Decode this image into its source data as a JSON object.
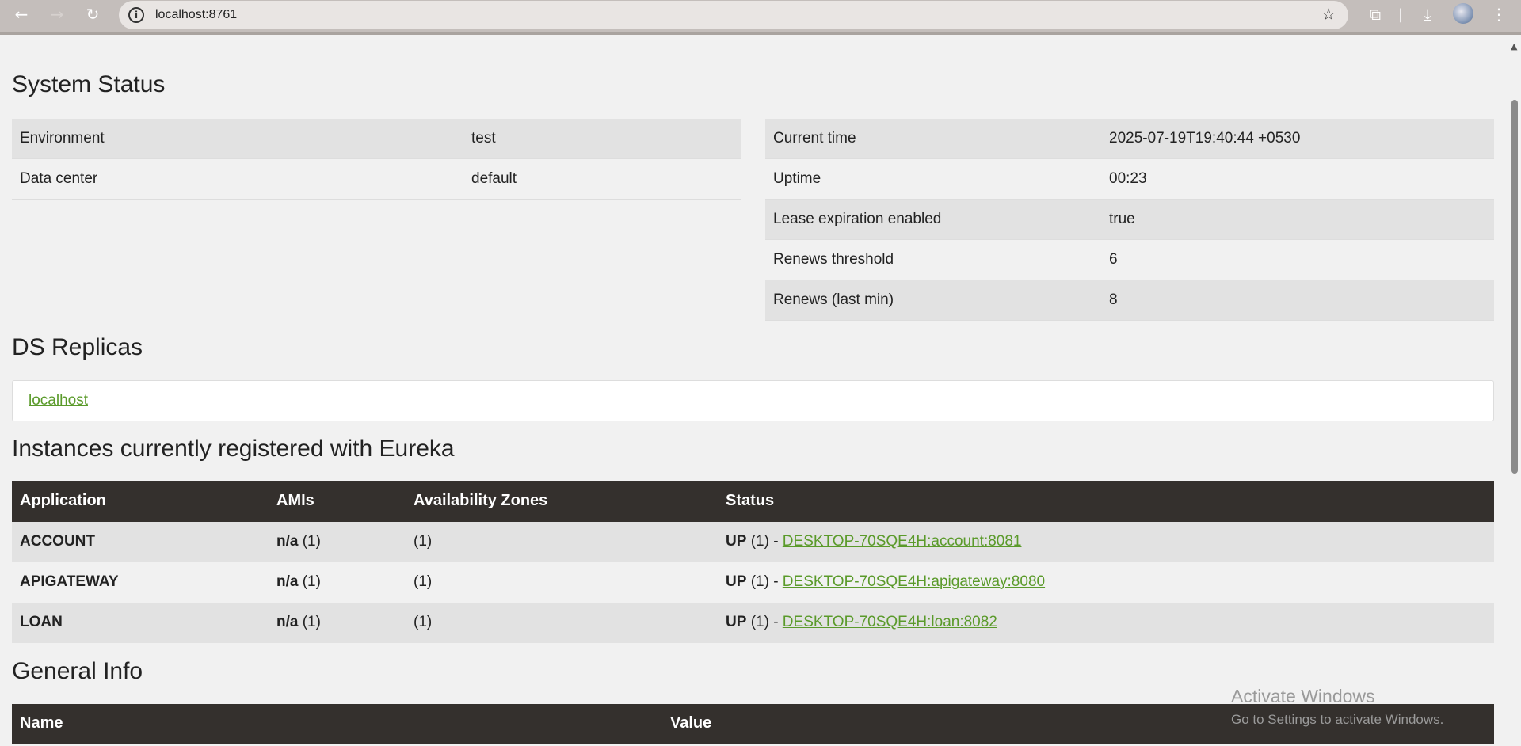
{
  "browser": {
    "back_icon": "arrow-left-icon",
    "forward_icon": "arrow-right-icon",
    "reload_icon": "reload-icon",
    "url": "localhost:8761",
    "info_icon": "info-icon",
    "star_icon": "star-icon",
    "extensions_icon": "puzzle-icon",
    "download_icon": "download-icon",
    "menu_icon": "kebab-menu-icon"
  },
  "system_status": {
    "heading": "System Status",
    "left": [
      {
        "label": "Environment",
        "value": "test"
      },
      {
        "label": "Data center",
        "value": "default"
      }
    ],
    "right": [
      {
        "label": "Current time",
        "value": "2025-07-19T19:40:44 +0530"
      },
      {
        "label": "Uptime",
        "value": "00:23"
      },
      {
        "label": "Lease expiration enabled",
        "value": "true"
      },
      {
        "label": "Renews threshold",
        "value": "6"
      },
      {
        "label": "Renews (last min)",
        "value": "8"
      }
    ]
  },
  "replicas": {
    "heading": "DS Replicas",
    "link": "localhost"
  },
  "instances": {
    "heading": "Instances currently registered with Eureka",
    "columns": [
      "Application",
      "AMIs",
      "Availability Zones",
      "Status"
    ],
    "rows": [
      {
        "application": "ACCOUNT",
        "amis_bold": "n/a",
        "amis_count": "(1)",
        "zones": "(1)",
        "status_bold": "UP",
        "status_count": "(1) -",
        "link": "DESKTOP-70SQE4H:account:8081"
      },
      {
        "application": "APIGATEWAY",
        "amis_bold": "n/a",
        "amis_count": "(1)",
        "zones": "(1)",
        "status_bold": "UP",
        "status_count": "(1) -",
        "link": "DESKTOP-70SQE4H:apigateway:8080"
      },
      {
        "application": "LOAN",
        "amis_bold": "n/a",
        "amis_count": "(1)",
        "zones": "(1)",
        "status_bold": "UP",
        "status_count": "(1) -",
        "link": "DESKTOP-70SQE4H:loan:8082"
      }
    ]
  },
  "general_info": {
    "heading": "General Info",
    "columns": [
      "Name",
      "Value"
    ]
  },
  "watermark": {
    "line1": "Activate Windows",
    "line2": "Go to Settings to activate Windows."
  }
}
